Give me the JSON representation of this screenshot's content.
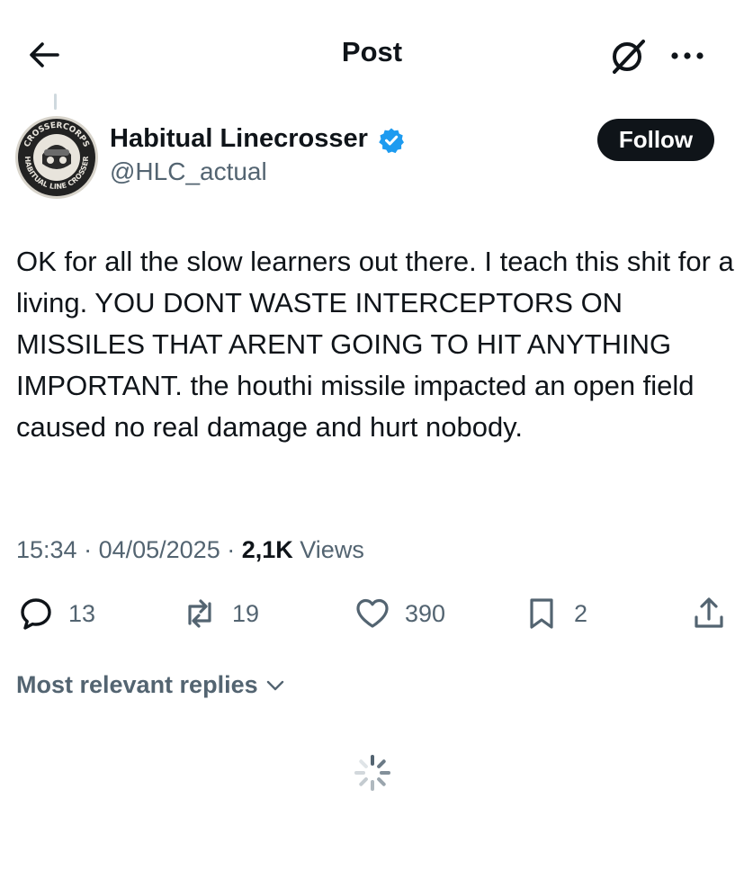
{
  "header": {
    "title": "Post"
  },
  "author": {
    "display_name": "Habitual Linecrosser",
    "handle": "@HLC_actual",
    "avatar_text_top": "CROSSERCORPS",
    "avatar_text_bottom": "HABITUAL LINE CROSSER"
  },
  "follow_label": "Follow",
  "post": {
    "text": "OK for all the slow learners out there. I teach this shit for a living. YOU DONT WASTE INTERCEPTORS ON MISSILES THAT ARENT GOING TO HIT ANYTHING IMPORTANT. the houthi missile impacted an open field caused no real damage and hurt nobody.",
    "time": "15:34",
    "date": "04/05/2025",
    "views_count": "2,1K",
    "views_label": "Views",
    "sep": " · "
  },
  "actions": {
    "replies": "13",
    "reposts": "19",
    "likes": "390",
    "bookmarks": "2"
  },
  "replies_sort": {
    "label": "Most relevant replies"
  },
  "colors": {
    "text": "#0f1419",
    "secondary": "#536471",
    "verified": "#1d9bf0",
    "follow_bg": "#0f1419"
  }
}
